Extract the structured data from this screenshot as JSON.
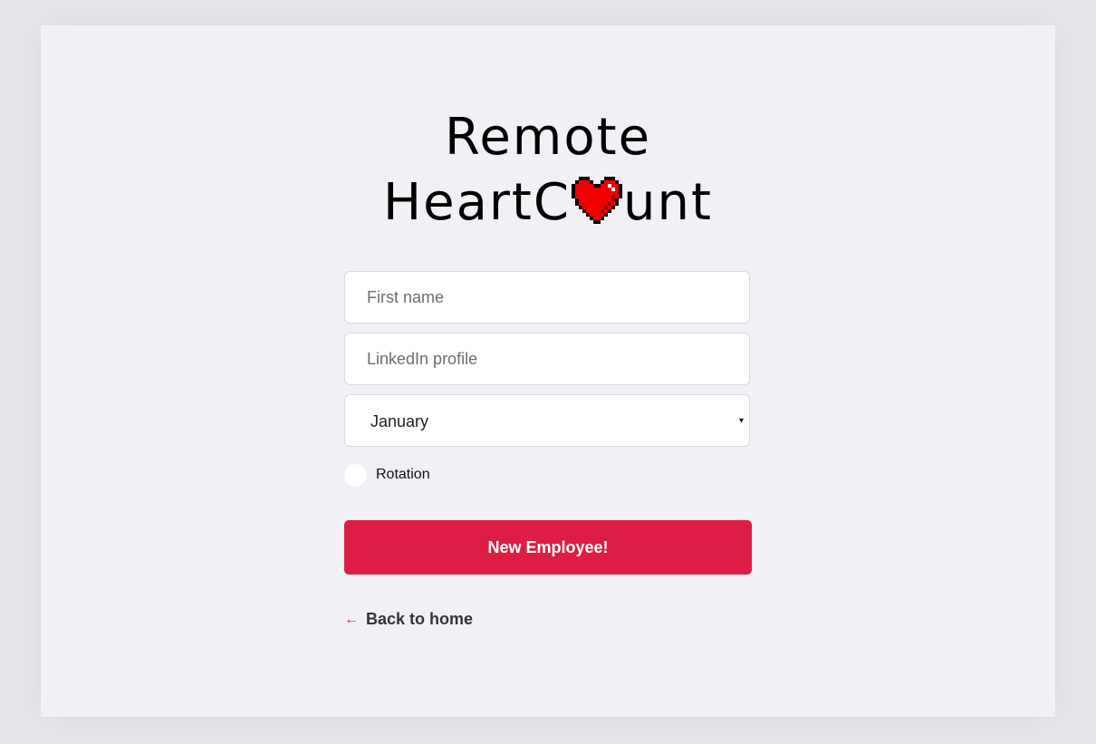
{
  "logo": {
    "line1": "Remote",
    "line2_before": "HeartC",
    "line2_after": "unt",
    "heart_icon": "pixel-heart-icon"
  },
  "form": {
    "first_name": {
      "placeholder": "First name",
      "value": ""
    },
    "linkedin": {
      "placeholder": "LinkedIn profile",
      "value": ""
    },
    "month": {
      "selected": "January",
      "caret": "▾"
    },
    "rotation": {
      "label": "Rotation",
      "checked": false
    },
    "submit_label": "New Employee!"
  },
  "back": {
    "arrow": "←",
    "label": "Back to home"
  },
  "colors": {
    "accent": "#dc1e45",
    "background": "#f0f0f5",
    "heart": "#ee0000"
  }
}
